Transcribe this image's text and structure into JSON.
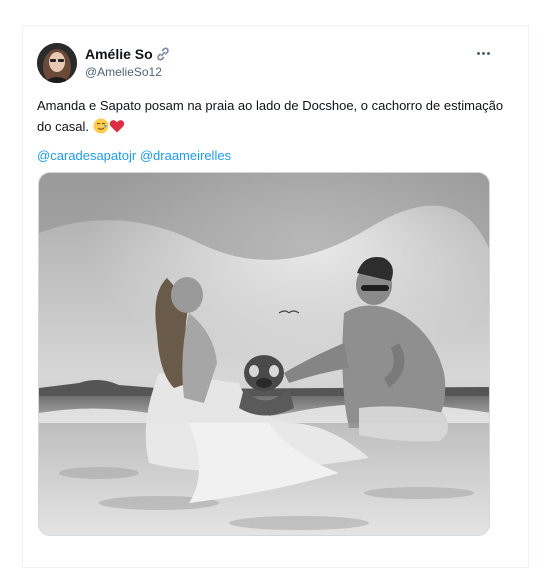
{
  "tweet": {
    "author_name": "Amélie So",
    "author_handle": "@AmelieSo12",
    "text": "Amanda e Sapato posam na praia ao lado de Docshoe, o cachorro de estimação do casal.",
    "emoji": [
      "smiling-face-with-tear",
      "red-heart"
    ],
    "mentions": [
      "@caradesapatojr",
      "@draameirelles"
    ]
  },
  "colors": {
    "link": "#1d9bf0",
    "secondary_text": "#536471",
    "heart": "#e0245e"
  },
  "icons": {
    "verified_link": "link-icon",
    "more": "more-icon"
  },
  "media": {
    "description_type": "black-and-white beach photo",
    "alt": ""
  }
}
